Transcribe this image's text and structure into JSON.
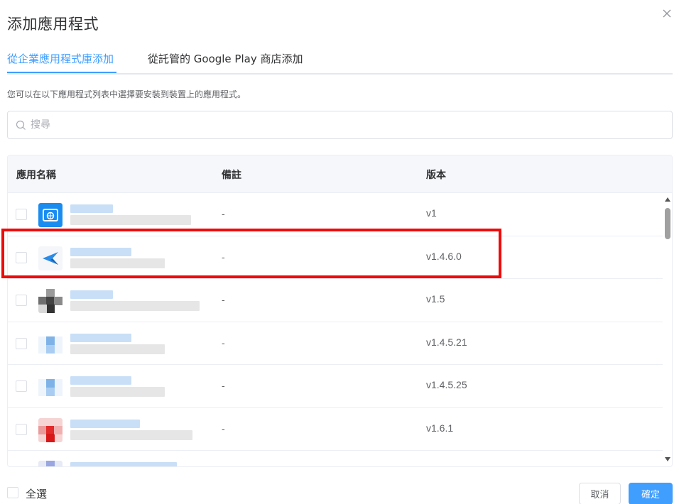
{
  "dialog": {
    "title": "添加應用程式",
    "description": "您可以在以下應用程式列表中選擇要安裝到裝置上的應用程式。"
  },
  "tabs": [
    {
      "label": "從企業應用程式庫添加",
      "active": true
    },
    {
      "label": "從託管的 Google Play 商店添加",
      "active": false
    }
  ],
  "search": {
    "placeholder": "搜尋",
    "value": ""
  },
  "table": {
    "columns": [
      "應用名稱",
      "備註",
      "版本"
    ],
    "rows": [
      {
        "icon": "browser-globe-icon",
        "note": "-",
        "version": "v1"
      },
      {
        "icon": "paper-plane-icon",
        "note": "-",
        "version": "v1.4.6.0"
      },
      {
        "icon": "pixelated-app-icon",
        "note": "-",
        "version": "v1.5"
      },
      {
        "icon": "pixelated-app-icon",
        "note": "-",
        "version": "v1.4.5.21"
      },
      {
        "icon": "pixelated-app-icon",
        "note": "-",
        "version": "v1.4.5.25"
      },
      {
        "icon": "pixelated-app-icon",
        "note": "-",
        "version": "v1.6.1"
      },
      {
        "icon": "pixelated-app-icon",
        "note": "",
        "version": ""
      }
    ]
  },
  "footer": {
    "select_all_label": "全選",
    "cancel_label": "取消",
    "confirm_label": "確定"
  },
  "colors": {
    "accent": "#409eff",
    "highlight": "#ef0a0a"
  }
}
